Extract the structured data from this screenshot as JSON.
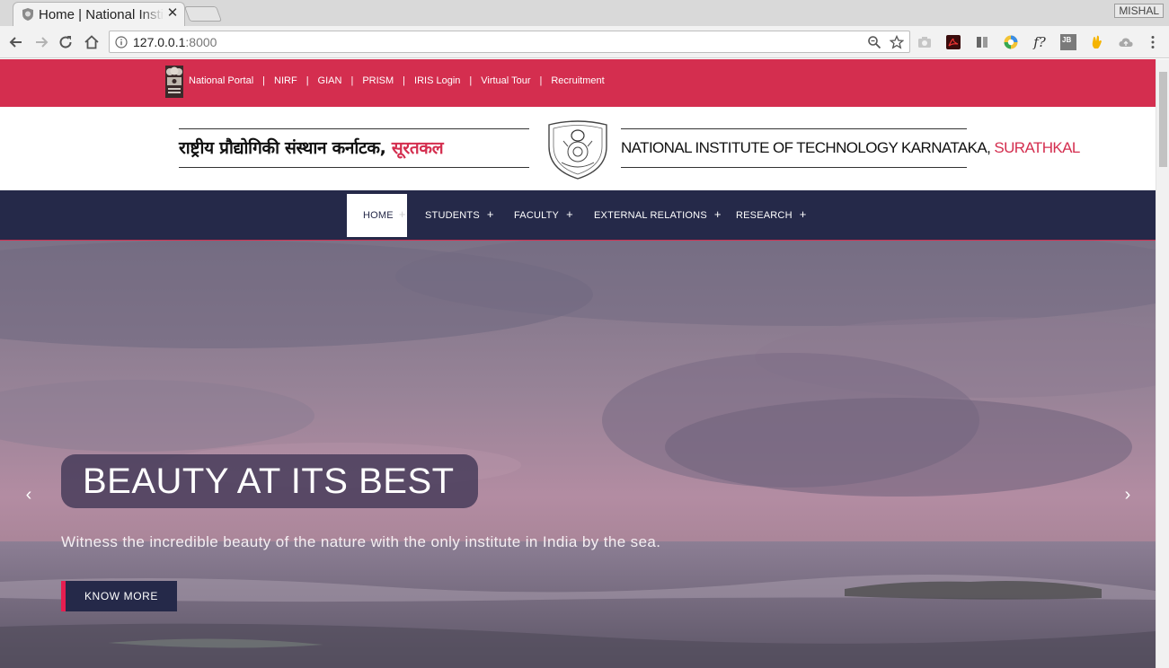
{
  "browser": {
    "tab_title": "Home | National Institute of Technology Karnataka, Surathkal",
    "tab_close": "✕",
    "profile_name": "MISHAL",
    "url_host": "127.0.0.1",
    "url_port": ":8000",
    "extensions": [
      "camera-icon",
      "pdf-icon",
      "bookmark-manager-icon",
      "chrome-extension-icon",
      "formula-icon",
      "jb-icon",
      "hand-icon",
      "cloud-icon"
    ],
    "ext_formula_label": "f?",
    "ext_jb_label": "JB"
  },
  "topbar": {
    "links": [
      "National Portal",
      "NIRF",
      "GIAN",
      "PRISM",
      "IRIS Login",
      "Virtual Tour",
      "Recruitment"
    ],
    "separator": "|"
  },
  "header": {
    "hindi_main": "राष्ट्रीय प्रौद्योगिकी संस्थान कर्नाटक, ",
    "hindi_highlight": "सूरतकल",
    "english_main": "NATIONAL INSTITUTE OF TECHNOLOGY KARNATAKA, ",
    "english_highlight": "SURATHKAL"
  },
  "nav": {
    "items": [
      {
        "label": "HOME",
        "plus": "+"
      },
      {
        "label": "STUDENTS",
        "plus": "+"
      },
      {
        "label": "FACULTY",
        "plus": "+"
      },
      {
        "label": "EXTERNAL RELATIONS",
        "plus": "+"
      },
      {
        "label": "RESEARCH",
        "plus": "+"
      }
    ]
  },
  "hero": {
    "title": "BEAUTY AT ITS BEST",
    "subtitle": "Witness the incredible beauty of the nature with the only institute in India by the sea.",
    "button": "KNOW MORE",
    "prev": "‹",
    "next": "›"
  },
  "colors": {
    "brand_red": "#d42e4f",
    "nav_navy": "#252949",
    "button_accent": "#e61e50"
  }
}
